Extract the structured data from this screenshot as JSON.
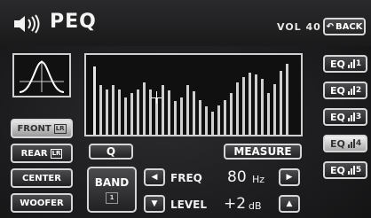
{
  "header": {
    "title": "PEQ",
    "volume": "VOL 40",
    "back_label": "BACK"
  },
  "sidebar": {
    "items": [
      {
        "label": "FRONT",
        "badge": "LR",
        "active": true
      },
      {
        "label": "REAR",
        "badge": "LR",
        "active": false
      },
      {
        "label": "CENTER",
        "badge": "",
        "active": false
      },
      {
        "label": "WOOFER",
        "badge": "",
        "active": false
      }
    ]
  },
  "eq_presets": [
    {
      "label": "EQ",
      "number": "1",
      "active": false
    },
    {
      "label": "EQ",
      "number": "2",
      "active": false
    },
    {
      "label": "EQ",
      "number": "3",
      "active": false
    },
    {
      "label": "EQ",
      "number": "4",
      "active": true
    },
    {
      "label": "EQ",
      "number": "5",
      "active": false
    }
  ],
  "graph": {
    "band_levels": [
      0.86,
      0.62,
      0.57,
      0.62,
      0.57,
      0.47,
      0.52,
      0.57,
      0.66,
      0.57,
      0.47,
      0.62,
      0.56,
      0.42,
      0.47,
      0.62,
      0.54,
      0.43,
      0.36,
      0.29,
      0.37,
      0.43,
      0.52,
      0.66,
      0.72,
      0.78,
      0.75,
      0.7,
      0.52,
      0.63,
      0.8,
      0.89
    ],
    "selected_band_index": 10
  },
  "controls": {
    "q_label": "Q",
    "measure_label": "MEASURE",
    "band_label": "BAND",
    "band_number": "1",
    "freq_label": "FREQ",
    "freq_value": "80",
    "freq_unit": "Hz",
    "level_label": "LEVEL",
    "level_value": "+2",
    "level_unit": "dB"
  }
}
